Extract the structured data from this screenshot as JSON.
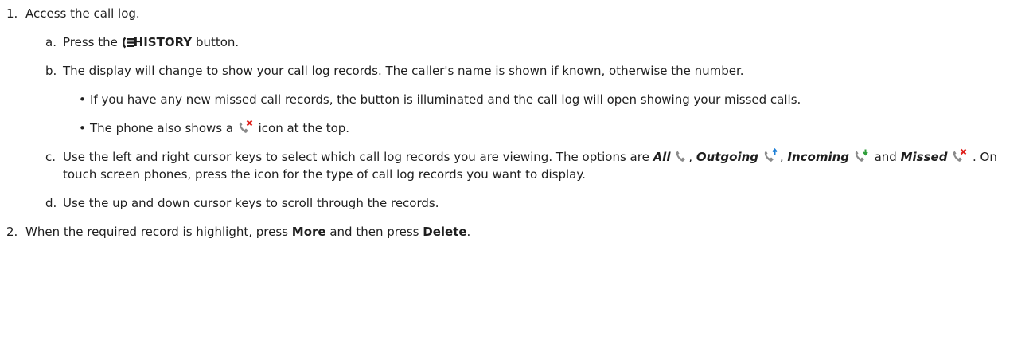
{
  "steps": [
    {
      "number": "1.",
      "text": "Access the call log.",
      "substeps": [
        {
          "letter": "a.",
          "pre": "Press the",
          "history_icon": "history-list-icon",
          "button_label": "HISTORY",
          "post": "button."
        },
        {
          "letter": "b.",
          "text": "The display will change to show your call log records. The caller's name is shown if known, otherwise the number.",
          "bullets": [
            "If you have any new missed call records, the button is illuminated and the call log will open showing your missed calls.",
            {
              "pre": "The phone also shows a",
              "icon": "missed-call-icon",
              "post": "icon at the top."
            }
          ]
        },
        {
          "letter": "c.",
          "pre": "Use the left and right cursor keys to select which call log records you are viewing. The options are",
          "opt_all": "All",
          "sep1": ",",
          "opt_outgoing": "Outgoing",
          "sep2": ",",
          "opt_incoming": "Incoming",
          "and_word": "and",
          "opt_missed": "Missed",
          "post": ". On touch screen phones, press the icon for the type of call log records you want to display.",
          "icons": [
            "all-calls-icon",
            "outgoing-call-icon",
            "incoming-call-icon",
            "missed-call-icon"
          ]
        },
        {
          "letter": "d.",
          "text": "Use the up and down cursor keys to scroll through the records."
        }
      ]
    },
    {
      "number": "2.",
      "pre": "When the required record is highlight, press",
      "more": "More",
      "mid": "and then press",
      "delete": "Delete",
      "post": "."
    }
  ],
  "colors": {
    "text": "#1f1f1f",
    "handset": "#8a8a8a",
    "missed_x": "#e0201b",
    "outgoing_arrow": "#1e7fd6",
    "incoming_arrow": "#2f9e3a"
  }
}
